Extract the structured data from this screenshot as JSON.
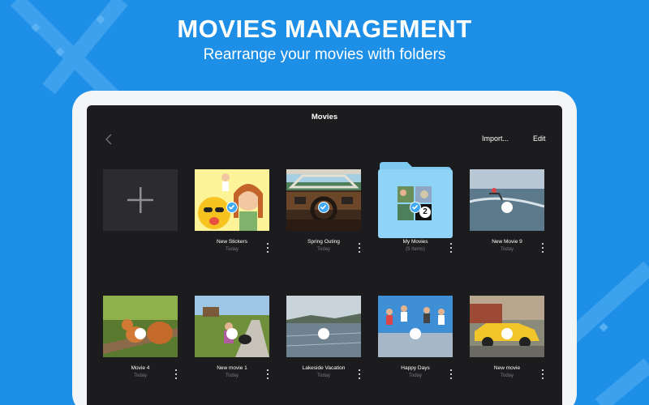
{
  "hero": {
    "title": "MOVIES MANAGEMENT",
    "subtitle": "Rearrange your movies with folders"
  },
  "nav": {
    "title": "Movies",
    "back_icon": "chevron-left-icon",
    "import_label": "Import...",
    "edit_label": "Edit"
  },
  "add_tile": {
    "icon": "plus-icon"
  },
  "items": [
    {
      "name": "New Stickers",
      "sub": "Today",
      "kind": "movie",
      "selected": true
    },
    {
      "name": "Spring Outing",
      "sub": "Today",
      "kind": "movie",
      "selected": true
    },
    {
      "name": "My Movies",
      "sub": "(5 Items)",
      "kind": "folder",
      "selected": true,
      "badge": "2"
    },
    {
      "name": "New Movie 9",
      "sub": "Today",
      "kind": "movie",
      "selected": false
    },
    {
      "name": "Movie 4",
      "sub": "Today",
      "kind": "movie",
      "selected": false
    },
    {
      "name": "New movie 1",
      "sub": "Today",
      "kind": "movie",
      "selected": false
    },
    {
      "name": "Lakeside Vacation",
      "sub": "Today",
      "kind": "movie",
      "selected": false
    },
    {
      "name": "Happy Days",
      "sub": "Today",
      "kind": "movie",
      "selected": false
    },
    {
      "name": "New movie",
      "sub": "Today",
      "kind": "movie",
      "selected": false
    }
  ],
  "colors": {
    "background": "#1e8fe6",
    "screen": "#1c1c1e",
    "accent": "#3fa9f5",
    "folder": "#8fd3f7"
  }
}
